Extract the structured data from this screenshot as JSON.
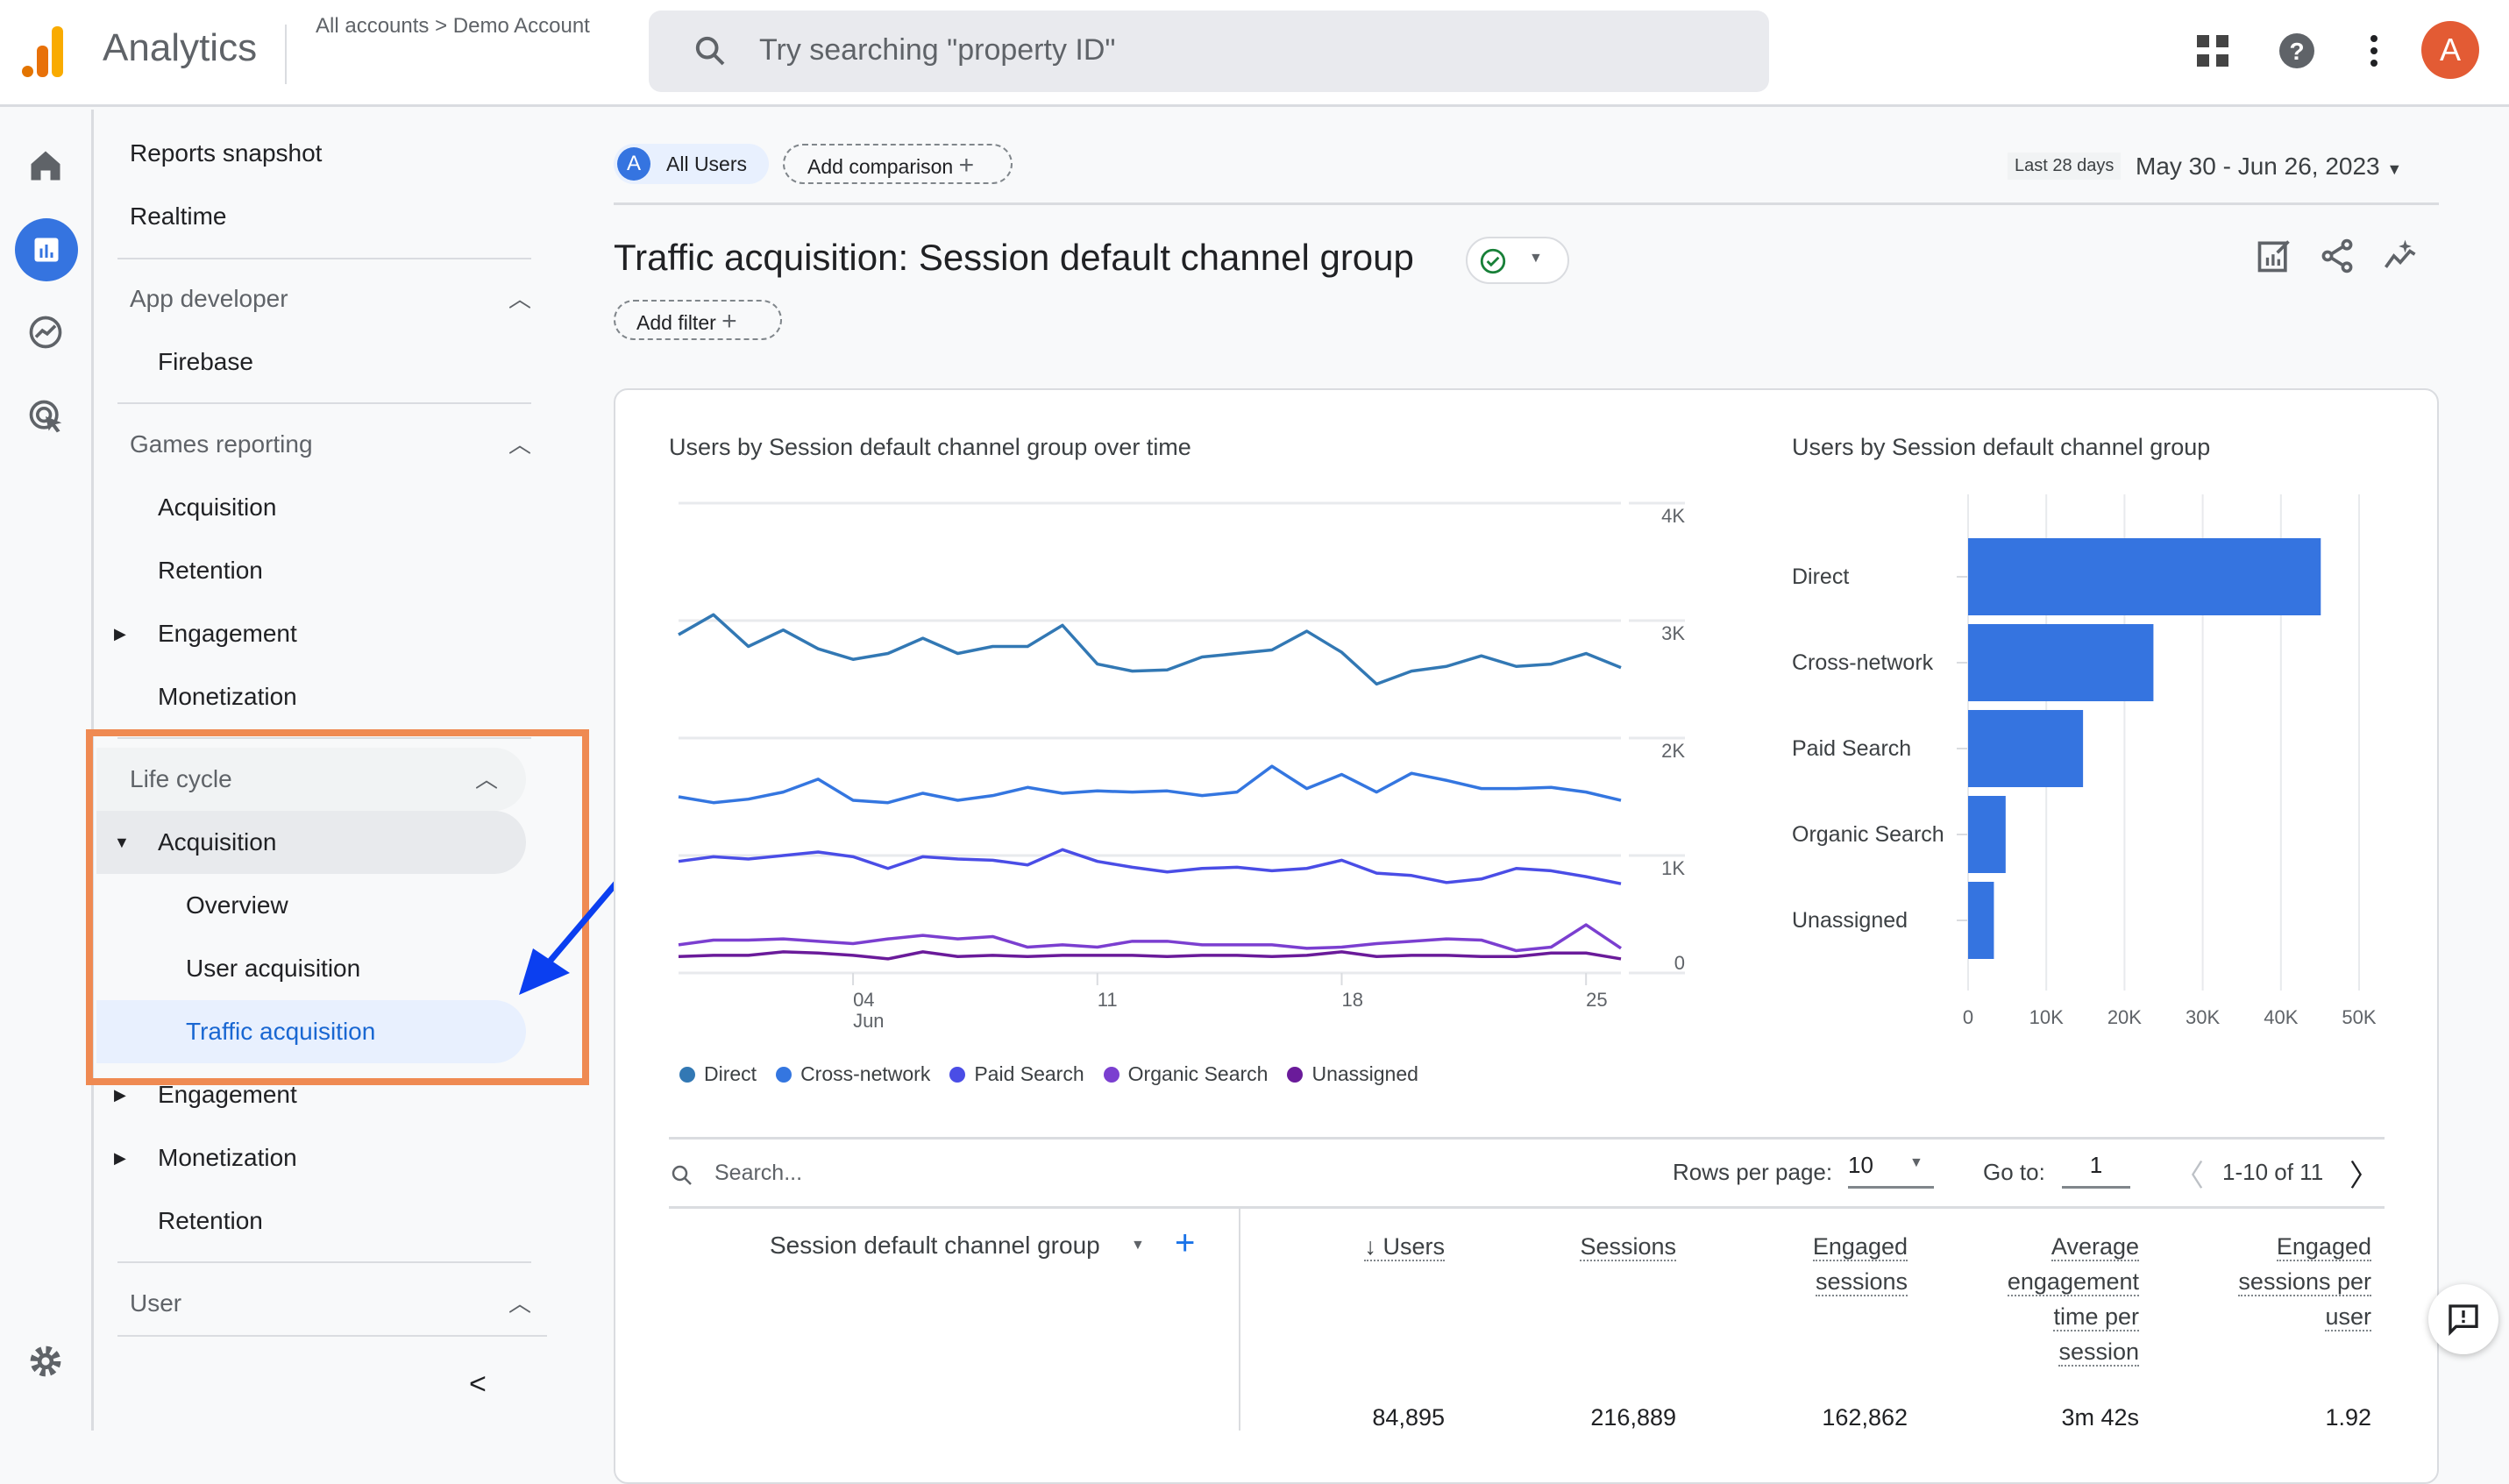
{
  "header": {
    "app_name": "Analytics",
    "breadcrumb": {
      "account": "All accounts",
      "separator": ">",
      "property": "Demo Account"
    },
    "search_placeholder": "Try searching \"property ID\"",
    "avatar_letter": "A",
    "avatar_color": "#e35b34"
  },
  "rail": {
    "items": [
      "home-icon",
      "reports-icon",
      "explore-icon",
      "advertising-icon"
    ],
    "settings": "gear-icon"
  },
  "nav": {
    "reports_snapshot": "Reports snapshot",
    "realtime": "Realtime",
    "app_developer": "App developer",
    "firebase": "Firebase",
    "games_reporting": "Games reporting",
    "games": [
      "Acquisition",
      "Retention",
      "Engagement",
      "Monetization"
    ],
    "life_cycle": "Life cycle",
    "lc_acquisition": "Acquisition",
    "lc_sub": [
      "Overview",
      "User acquisition",
      "Traffic acquisition"
    ],
    "lc_rest": [
      "Engagement",
      "Monetization",
      "Retention"
    ],
    "user": "User",
    "collapse": "<"
  },
  "toolbar": {
    "segment_letter": "A",
    "segment": "All Users",
    "add_comparison": "Add comparison",
    "date_preset": "Last 28 days",
    "date_range": "May 30 - Jun 26, 2023",
    "title": "Traffic acquisition: Session default channel group",
    "add_filter": "Add filter"
  },
  "chart_data": [
    {
      "type": "line",
      "title": "Users by Session default channel group over time",
      "x": [
        "May 30",
        "May 31",
        "Jun 1",
        "Jun 2",
        "Jun 3",
        "Jun 4",
        "Jun 5",
        "Jun 6",
        "Jun 7",
        "Jun 8",
        "Jun 9",
        "Jun 10",
        "Jun 11",
        "Jun 12",
        "Jun 13",
        "Jun 14",
        "Jun 15",
        "Jun 16",
        "Jun 17",
        "Jun 18",
        "Jun 19",
        "Jun 20",
        "Jun 21",
        "Jun 22",
        "Jun 23",
        "Jun 24",
        "Jun 25",
        "Jun 26"
      ],
      "x_ticks": [
        {
          "label": "04",
          "sub": "Jun",
          "index": 5
        },
        {
          "label": "11",
          "index": 12
        },
        {
          "label": "18",
          "index": 19
        },
        {
          "label": "25",
          "index": 26
        }
      ],
      "y_ticks": [
        "0",
        "1K",
        "2K",
        "3K",
        "4K"
      ],
      "ylim": [
        0,
        4000
      ],
      "grid": true,
      "legend": "bottom",
      "series": [
        {
          "name": "Direct",
          "color": "#3278b4",
          "values": [
            2880,
            3050,
            2780,
            2920,
            2760,
            2670,
            2720,
            2850,
            2720,
            2780,
            2780,
            2960,
            2630,
            2570,
            2580,
            2690,
            2720,
            2750,
            2910,
            2730,
            2460,
            2570,
            2610,
            2700,
            2610,
            2630,
            2720,
            2600
          ]
        },
        {
          "name": "Cross-network",
          "color": "#3476e0",
          "values": [
            1500,
            1450,
            1480,
            1540,
            1650,
            1470,
            1450,
            1530,
            1470,
            1510,
            1580,
            1530,
            1550,
            1540,
            1550,
            1510,
            1540,
            1760,
            1570,
            1690,
            1540,
            1700,
            1640,
            1570,
            1570,
            1580,
            1540,
            1470
          ]
        },
        {
          "name": "Paid Search",
          "color": "#4a4de6",
          "values": [
            950,
            990,
            970,
            1000,
            1030,
            990,
            890,
            990,
            970,
            960,
            920,
            1050,
            950,
            900,
            860,
            890,
            900,
            870,
            890,
            960,
            850,
            830,
            770,
            800,
            890,
            870,
            820,
            760
          ]
        },
        {
          "name": "Organic Search",
          "color": "#7b3fd0",
          "values": [
            240,
            280,
            280,
            290,
            270,
            250,
            290,
            320,
            290,
            310,
            220,
            240,
            220,
            270,
            270,
            240,
            240,
            240,
            210,
            220,
            250,
            270,
            290,
            280,
            190,
            220,
            410,
            210
          ]
        },
        {
          "name": "Unassigned",
          "color": "#6a1b9a",
          "values": [
            140,
            150,
            150,
            180,
            170,
            150,
            120,
            180,
            140,
            150,
            140,
            150,
            150,
            150,
            140,
            150,
            150,
            140,
            150,
            180,
            140,
            150,
            150,
            140,
            140,
            170,
            170,
            120
          ]
        }
      ]
    },
    {
      "type": "bar",
      "orientation": "horizontal",
      "title": "Users by Session default channel group",
      "categories": [
        "Direct",
        "Cross-network",
        "Paid Search",
        "Organic Search",
        "Unassigned"
      ],
      "values": [
        45100,
        23700,
        14700,
        4800,
        3300
      ],
      "color": "#3574e0",
      "x_ticks": [
        "0",
        "10K",
        "20K",
        "30K",
        "40K",
        "50K"
      ],
      "xlim": [
        0,
        50000
      ],
      "grid": true
    }
  ],
  "table": {
    "search_placeholder": "Search...",
    "rows_per_page_label": "Rows per page:",
    "rows_per_page": "10",
    "goto_label": "Go to:",
    "goto_value": "1",
    "range": "1-10 of 11",
    "dimension_header": "Session default channel group",
    "columns": [
      [
        "Users"
      ],
      [
        "Sessions"
      ],
      [
        "Engaged",
        "sessions"
      ],
      [
        "Average",
        "engagement",
        "time per",
        "session"
      ],
      [
        "Engaged",
        "sessions per",
        "user"
      ]
    ],
    "totals": [
      "84,895",
      "216,889",
      "162,862",
      "3m 42s",
      "1.92"
    ]
  },
  "annotation": {
    "highlight_color": "#ef8a52",
    "arrow_color": "#0b3ff0"
  }
}
